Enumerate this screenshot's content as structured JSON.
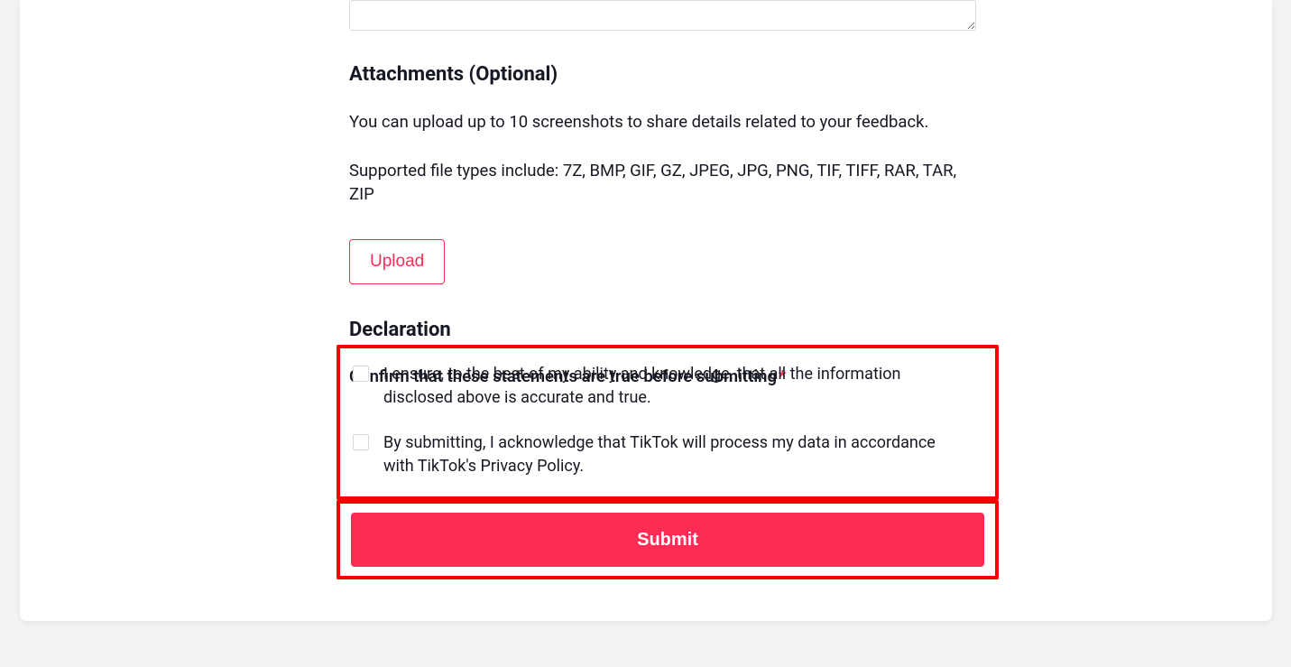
{
  "attachments": {
    "heading": "Attachments (Optional)",
    "help1": "You can upload up to 10 screenshots to share details related to your feedback.",
    "help2": "Supported file types include: 7Z, BMP, GIF, GZ, JPEG, JPG, PNG, TIF, TIFF, RAR, TAR, ZIP",
    "upload_label": "Upload"
  },
  "declaration": {
    "heading": "Declaration",
    "confirm_label": "Confirm that these statements are true before submitting",
    "required_mark": "*",
    "items": [
      "I ensure, to the best of my ability and knowledge, that all the information disclosed above is accurate and true.",
      "By submitting, I acknowledge that TikTok will process my data in accordance with TikTok's Privacy Policy."
    ]
  },
  "submit_label": "Submit",
  "colors": {
    "accent": "#fe2c55",
    "highlight_box": "#f90000",
    "text": "#161823",
    "border_light": "#d9d9d9"
  }
}
